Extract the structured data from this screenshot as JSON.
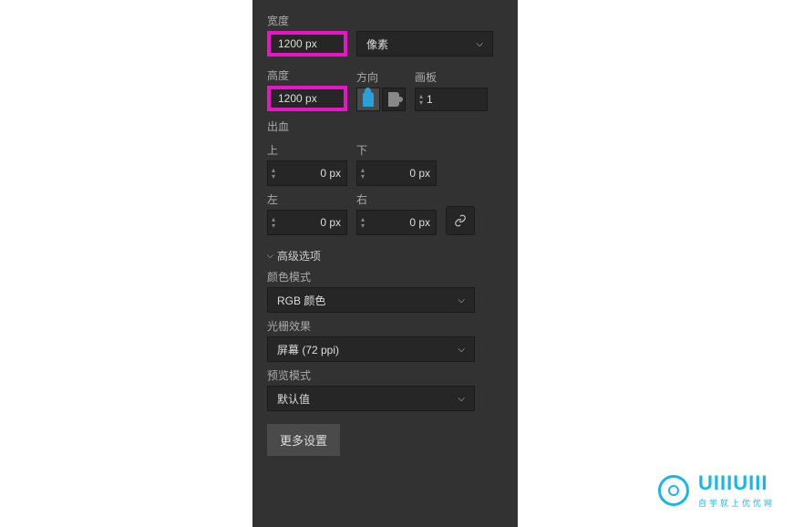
{
  "labels": {
    "width": "宽度",
    "height": "高度",
    "orientation": "方向",
    "artboard": "画板",
    "bleed": "出血",
    "top": "上",
    "bottom": "下",
    "left": "左",
    "right": "右",
    "advancedOptions": "高级选项",
    "colorMode": "颜色模式",
    "rasterEffects": "光栅效果",
    "previewMode": "预览模式"
  },
  "values": {
    "width": "1200 px",
    "height": "1200 px",
    "units": "像素",
    "artboardCount": "1",
    "bleedTop": "0 px",
    "bleedBottom": "0 px",
    "bleedLeft": "0 px",
    "bleedRight": "0 px",
    "colorMode": "RGB 颜色",
    "rasterEffects": "屏幕 (72 ppi)",
    "previewMode": "默认值"
  },
  "buttons": {
    "moreSettings": "更多设置"
  },
  "watermark": {
    "text": "UIIIUIII",
    "sub": "自学就上优优网"
  }
}
